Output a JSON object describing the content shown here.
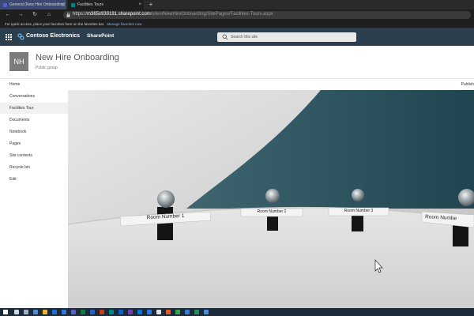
{
  "browser": {
    "tabs": [
      {
        "label": "General (New Hire Onboarding)",
        "active": false
      },
      {
        "label": "Facilities Tours",
        "active": true
      }
    ],
    "new_tab": "+",
    "url_prefix": "https://",
    "url_domain": "m365x939181.sharepoint.com",
    "url_path": "/sites/NewHireOnboarding/SitePages/Facilities-Tours.aspx",
    "favorites_text": "For quick access, place your favorites here on the favorites bar.",
    "favorites_link": "Manage favorites now"
  },
  "suite": {
    "brand": "Contoso Electronics",
    "app": "SharePoint",
    "search_placeholder": "Search this site"
  },
  "site": {
    "initials": "NH",
    "title": "New Hire Onboarding",
    "subtitle": "Public group",
    "command_right": "Publish"
  },
  "nav": [
    {
      "label": "Home"
    },
    {
      "label": "Conversations"
    },
    {
      "label": "Facilities Tour",
      "active": true
    },
    {
      "label": "Documents"
    },
    {
      "label": "Notebook"
    },
    {
      "label": "Pages"
    },
    {
      "label": "Site contents"
    },
    {
      "label": "Recycle bin"
    },
    {
      "label": "Edit"
    }
  ],
  "rooms": [
    {
      "label": "Room Number 1"
    },
    {
      "label": "Room Number 2"
    },
    {
      "label": "Room Number 3"
    },
    {
      "label": "Room Numbe"
    }
  ],
  "colors": {
    "suite_bar": "#2b3f4e",
    "wall": "#2f5560",
    "floor": "#d7d7d7",
    "accent": "#0078d4"
  }
}
